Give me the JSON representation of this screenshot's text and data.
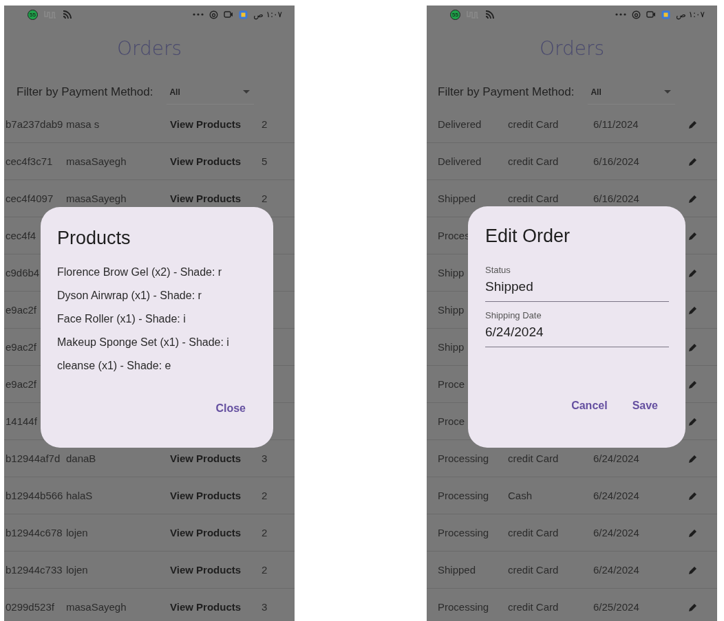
{
  "screens": [
    {
      "status_bar": {
        "badge": "55",
        "time": "١:٠٧ ص"
      },
      "title": "Orders",
      "filter": {
        "label": "Filter by Payment Method:",
        "value": "All"
      },
      "columns": [
        {
          "kind": "text"
        },
        {
          "kind": "text"
        },
        {
          "kind": "link"
        },
        {
          "kind": "text"
        }
      ],
      "rows": [
        {
          "cells": [
            "b7a237dab9",
            "masa s",
            "View Products",
            "2"
          ]
        },
        {
          "cells": [
            "cec4f3c71",
            "masaSayegh",
            "View Products",
            "5"
          ]
        },
        {
          "cells": [
            "cec4f4097",
            "masaSayegh",
            "View Products",
            "2"
          ]
        },
        {
          "cells": [
            "cec4f4"
          ]
        },
        {
          "cells": [
            "c9d6b4"
          ]
        },
        {
          "cells": [
            "e9ac2f"
          ]
        },
        {
          "cells": [
            "e9ac2f"
          ]
        },
        {
          "cells": [
            "e9ac2f"
          ]
        },
        {
          "cells": [
            "14144f"
          ]
        },
        {
          "cells": [
            "b12944af7d",
            "danaB",
            "View Products",
            "3"
          ]
        },
        {
          "cells": [
            "b12944b566",
            "halaS",
            "View Products",
            "2"
          ]
        },
        {
          "cells": [
            "b12944c678",
            "lojen",
            "View Products",
            "2"
          ]
        },
        {
          "cells": [
            "b12944c733",
            "lojen",
            "View Products",
            "2"
          ]
        },
        {
          "cells": [
            "0299d523f",
            "masaSayegh",
            "View Products",
            "3"
          ]
        }
      ],
      "dialog": {
        "kind": "list",
        "title": "Products",
        "lines": [
          "Florence Brow Gel (x2) - Shade: r",
          "Dyson Airwrap (x1) - Shade: r",
          "Face Roller (x1) - Shade: i",
          "Makeup Sponge Set (x1) - Shade: i",
          "cleanse (x1) - Shade: e"
        ],
        "actions": [
          "Close"
        ]
      }
    },
    {
      "status_bar": {
        "badge": "55",
        "time": "١:٠٧ ص"
      },
      "title": "Orders",
      "filter": {
        "label": "Filter by Payment Method:",
        "value": "All"
      },
      "columns": [
        {
          "kind": "text"
        },
        {
          "kind": "text"
        },
        {
          "kind": "text"
        },
        {
          "kind": "edit"
        }
      ],
      "rows": [
        {
          "cells": [
            "Delivered",
            "credit Card",
            "6/11/2024"
          ]
        },
        {
          "cells": [
            "Delivered",
            "credit Card",
            "6/16/2024"
          ]
        },
        {
          "cells": [
            "Shipped",
            "credit Card",
            "6/16/2024"
          ]
        },
        {
          "cells": [
            "Proces"
          ]
        },
        {
          "cells": [
            "Shipp"
          ]
        },
        {
          "cells": [
            "Shipp"
          ]
        },
        {
          "cells": [
            "Shipp"
          ]
        },
        {
          "cells": [
            "Proce"
          ]
        },
        {
          "cells": [
            "Proce"
          ]
        },
        {
          "cells": [
            "Processing",
            "credit Card",
            "6/24/2024"
          ]
        },
        {
          "cells": [
            "Processing",
            "Cash",
            "6/24/2024"
          ]
        },
        {
          "cells": [
            "Processing",
            "credit Card",
            "6/24/2024"
          ]
        },
        {
          "cells": [
            "Shipped",
            "credit Card",
            "6/24/2024"
          ]
        },
        {
          "cells": [
            "Processing",
            "credit Card",
            "6/25/2024"
          ]
        }
      ],
      "dialog": {
        "kind": "form",
        "title": "Edit Order",
        "fields": [
          {
            "label": "Status",
            "value": "Shipped"
          },
          {
            "label": "Shipping Date",
            "value": "6/24/2024"
          }
        ],
        "actions": [
          "Cancel",
          "Save"
        ]
      }
    }
  ]
}
